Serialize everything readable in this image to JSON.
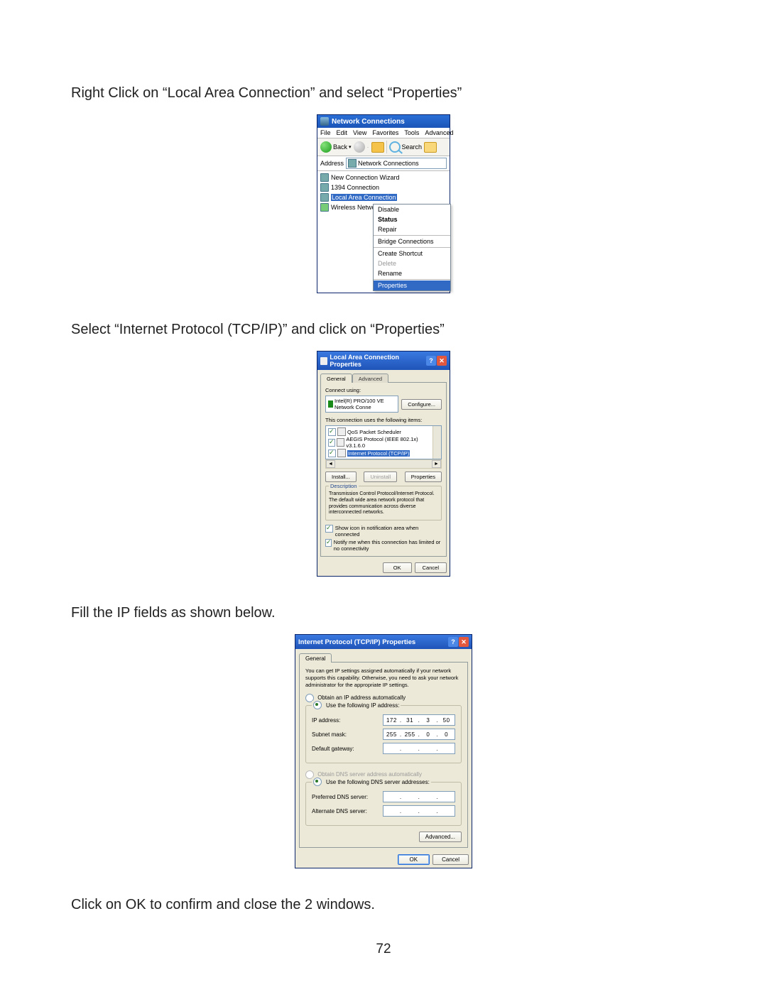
{
  "instructions": {
    "step1": "Right Click on “Local Area Connection” and select “Properties”",
    "step2": "Select “Internet Protocol (TCP/IP)” and click on “Properties”",
    "step3": "Fill the IP fields as shown below.",
    "step4": "Click on OK to confirm and close the 2 windows."
  },
  "page_number": "72",
  "nc": {
    "title": "Network Connections",
    "menubar": [
      "File",
      "Edit",
      "View",
      "Favorites",
      "Tools",
      "Advanced"
    ],
    "toolbar": {
      "back": "Back",
      "search": "Search"
    },
    "address_label": "Address",
    "address_value": "Network Connections",
    "items": [
      {
        "label": "New Connection Wizard"
      },
      {
        "label": "1394 Connection"
      },
      {
        "label": "Local Area Connection",
        "selected": true
      },
      {
        "label": "Wireless Network C"
      }
    ],
    "context_menu": {
      "disable": "Disable",
      "status": "Status",
      "repair": "Repair",
      "bridge": "Bridge Connections",
      "shortcut": "Create Shortcut",
      "delete": "Delete",
      "rename": "Rename",
      "properties": "Properties"
    }
  },
  "lac": {
    "title": "Local Area Connection Properties",
    "tabs": {
      "general": "General",
      "advanced": "Advanced"
    },
    "connect_using": "Connect using:",
    "adapter": "Intel(R) PRO/100 VE Network Conne",
    "configure": "Configure...",
    "uses_items": "This connection uses the following items:",
    "items": [
      {
        "label": "QoS Packet Scheduler"
      },
      {
        "label": "AEGIS Protocol (IEEE 802.1x) v3.1.6.0"
      },
      {
        "label": "Internet Protocol (TCP/IP)",
        "selected": true
      }
    ],
    "install": "Install...",
    "uninstall": "Uninstall",
    "properties": "Properties",
    "description_label": "Description",
    "description_text": "Transmission Control Protocol/Internet Protocol. The default wide area network protocol that provides communication across diverse interconnected networks.",
    "show_icon": "Show icon in notification area when connected",
    "notify": "Notify me when this connection has limited or no connectivity",
    "ok": "OK",
    "cancel": "Cancel"
  },
  "ip": {
    "title": "Internet Protocol (TCP/IP) Properties",
    "tab_general": "General",
    "desc": "You can get IP settings assigned automatically if your network supports this capability. Otherwise, you need to ask your network administrator for the appropriate IP settings.",
    "obtain_ip": "Obtain an IP address automatically",
    "use_ip": "Use the following IP address:",
    "ip_label": "IP address:",
    "ip_value": [
      "172",
      "31",
      "3",
      "50"
    ],
    "subnet_label": "Subnet mask:",
    "subnet_value": [
      "255",
      "255",
      "0",
      "0"
    ],
    "gw_label": "Default gateway:",
    "gw_value": [
      "",
      "",
      "",
      ""
    ],
    "obtain_dns": "Obtain DNS server address automatically",
    "use_dns": "Use the following DNS server addresses:",
    "preferred_dns": "Preferred DNS server:",
    "preferred_dns_value": [
      "",
      "",
      "",
      ""
    ],
    "alternate_dns": "Alternate DNS server:",
    "alternate_dns_value": [
      "",
      "",
      "",
      ""
    ],
    "advanced": "Advanced...",
    "ok": "OK",
    "cancel": "Cancel"
  }
}
